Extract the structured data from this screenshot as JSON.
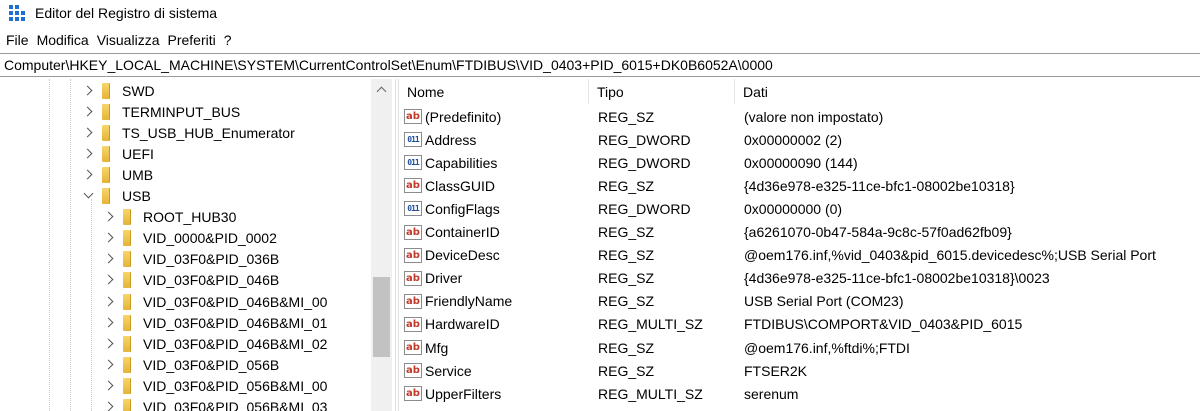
{
  "window": {
    "title": "Editor del Registro di sistema",
    "icon": "regedit-icon"
  },
  "menu": [
    "File",
    "Modifica",
    "Visualizza",
    "Preferiti",
    "?"
  ],
  "address": "Computer\\HKEY_LOCAL_MACHINE\\SYSTEM\\CurrentControlSet\\Enum\\FTDIBUS\\VID_0403+PID_6015+DK0B6052A\\0000",
  "tree": {
    "items": [
      {
        "label": "SWD",
        "level": 1,
        "expanded": false
      },
      {
        "label": "TERMINPUT_BUS",
        "level": 1,
        "expanded": false
      },
      {
        "label": "TS_USB_HUB_Enumerator",
        "level": 1,
        "expanded": false
      },
      {
        "label": "UEFI",
        "level": 1,
        "expanded": false
      },
      {
        "label": "UMB",
        "level": 1,
        "expanded": false
      },
      {
        "label": "USB",
        "level": 1,
        "expanded": true
      },
      {
        "label": "ROOT_HUB30",
        "level": 2,
        "expanded": false
      },
      {
        "label": "VID_0000&PID_0002",
        "level": 2,
        "expanded": false
      },
      {
        "label": "VID_03F0&PID_036B",
        "level": 2,
        "expanded": false
      },
      {
        "label": "VID_03F0&PID_046B",
        "level": 2,
        "expanded": false
      },
      {
        "label": "VID_03F0&PID_046B&MI_00",
        "level": 2,
        "expanded": false
      },
      {
        "label": "VID_03F0&PID_046B&MI_01",
        "level": 2,
        "expanded": false
      },
      {
        "label": "VID_03F0&PID_046B&MI_02",
        "level": 2,
        "expanded": false
      },
      {
        "label": "VID_03F0&PID_056B",
        "level": 2,
        "expanded": false
      },
      {
        "label": "VID_03F0&PID_056B&MI_00",
        "level": 2,
        "expanded": false
      },
      {
        "label": "VID_03F0&PID_056B&MI_03",
        "level": 2,
        "expanded": false
      }
    ]
  },
  "values": {
    "columns": [
      "Nome",
      "Tipo",
      "Dati"
    ],
    "rows": [
      {
        "icon": "string-value-icon",
        "name": "(Predefinito)",
        "type": "REG_SZ",
        "data": "(valore non impostato)"
      },
      {
        "icon": "binary-value-icon",
        "name": "Address",
        "type": "REG_DWORD",
        "data": "0x00000002 (2)"
      },
      {
        "icon": "binary-value-icon",
        "name": "Capabilities",
        "type": "REG_DWORD",
        "data": "0x00000090 (144)"
      },
      {
        "icon": "string-value-icon",
        "name": "ClassGUID",
        "type": "REG_SZ",
        "data": "{4d36e978-e325-11ce-bfc1-08002be10318}"
      },
      {
        "icon": "binary-value-icon",
        "name": "ConfigFlags",
        "type": "REG_DWORD",
        "data": "0x00000000 (0)"
      },
      {
        "icon": "string-value-icon",
        "name": "ContainerID",
        "type": "REG_SZ",
        "data": "{a6261070-0b47-584a-9c8c-57f0ad62fb09}"
      },
      {
        "icon": "string-value-icon",
        "name": "DeviceDesc",
        "type": "REG_SZ",
        "data": "@oem176.inf,%vid_0403&pid_6015.devicedesc%;USB Serial Port"
      },
      {
        "icon": "string-value-icon",
        "name": "Driver",
        "type": "REG_SZ",
        "data": "{4d36e978-e325-11ce-bfc1-08002be10318}\\0023"
      },
      {
        "icon": "string-value-icon",
        "name": "FriendlyName",
        "type": "REG_SZ",
        "data": "USB Serial Port (COM23)"
      },
      {
        "icon": "string-value-icon",
        "name": "HardwareID",
        "type": "REG_MULTI_SZ",
        "data": "FTDIBUS\\COMPORT&VID_0403&PID_6015"
      },
      {
        "icon": "string-value-icon",
        "name": "Mfg",
        "type": "REG_SZ",
        "data": "@oem176.inf,%ftdi%;FTDI"
      },
      {
        "icon": "string-value-icon",
        "name": "Service",
        "type": "REG_SZ",
        "data": "FTSER2K"
      },
      {
        "icon": "string-value-icon",
        "name": "UpperFilters",
        "type": "REG_MULTI_SZ",
        "data": "serenum"
      }
    ]
  },
  "colors": {
    "folder": "#e6b437",
    "string_icon": "#c0392b",
    "binary_icon": "#1e4e9c",
    "scroll_thumb": "#c2c2c2"
  }
}
